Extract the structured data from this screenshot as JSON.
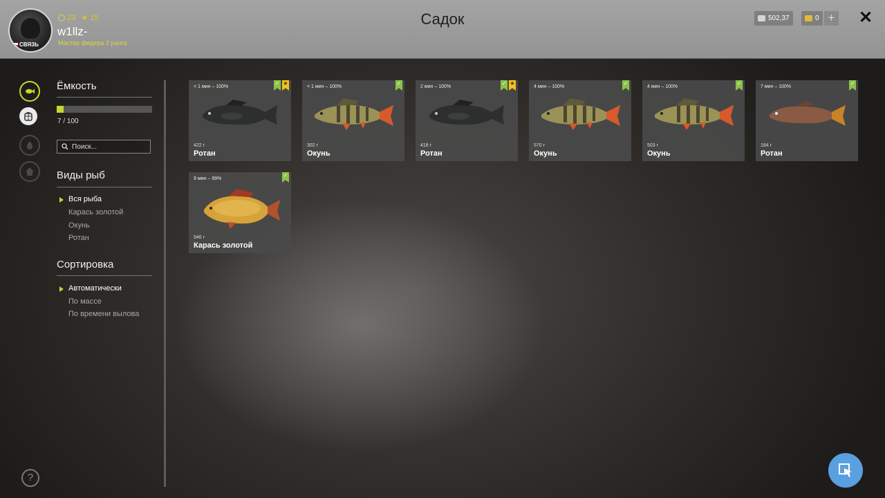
{
  "header": {
    "title": "Садок",
    "player": {
      "level": "23",
      "stars": "15",
      "username": "w1llz-",
      "rank": "Мастер фидера 2 ранга",
      "avatar_tag": "СВЯЗЬ"
    },
    "currency": {
      "silver": "502,37",
      "gold": "0"
    },
    "plus_label": "+",
    "close_label": "✕"
  },
  "sidebar": {
    "capacity": {
      "title": "Ёмкость",
      "current": 7,
      "max": 100,
      "label": "7 / 100",
      "fill_fraction": 0.07
    },
    "search": {
      "placeholder": "Поиск..."
    },
    "species": {
      "title": "Виды рыб",
      "items": [
        {
          "label": "Вся рыба",
          "selected": true
        },
        {
          "label": "Карась золотой",
          "selected": false
        },
        {
          "label": "Окунь",
          "selected": false
        },
        {
          "label": "Ротан",
          "selected": false
        }
      ]
    },
    "sort": {
      "title": "Сортировка",
      "items": [
        {
          "label": "Автоматически",
          "selected": true
        },
        {
          "label": "По массе",
          "selected": false
        },
        {
          "label": "По времени вылова",
          "selected": false
        }
      ]
    },
    "help_label": "?"
  },
  "cards": [
    {
      "time": "< 1 мин – 100%",
      "mass": "422 г",
      "name": "Ротан",
      "badges": [
        "green",
        "gold"
      ],
      "fish": "rotan-dark"
    },
    {
      "time": "< 1 мин – 100%",
      "mass": "302 г",
      "name": "Окунь",
      "badges": [
        "green"
      ],
      "fish": "perch"
    },
    {
      "time": "2 мин – 100%",
      "mass": "418 г",
      "name": "Ротан",
      "badges": [
        "green",
        "gold"
      ],
      "fish": "rotan-dark"
    },
    {
      "time": "4 мин – 100%",
      "mass": "570 г",
      "name": "Окунь",
      "badges": [
        "green"
      ],
      "fish": "perch"
    },
    {
      "time": "4 мин – 100%",
      "mass": "503 г",
      "name": "Окунь",
      "badges": [
        "green"
      ],
      "fish": "perch"
    },
    {
      "time": "7 мин – 100%",
      "mass": "184 г",
      "name": "Ротан",
      "badges": [
        "green"
      ],
      "fish": "rotan-brown"
    },
    {
      "time": "9 мин – 99%",
      "mass": "946 г",
      "name": "Карась золотой",
      "badges": [
        "green"
      ],
      "fish": "crucian"
    }
  ],
  "colors": {
    "accent": "#c6d630",
    "badge_green": "#8bc34a",
    "badge_gold": "#f0c419",
    "cursor_button": "#5a9fe0"
  }
}
